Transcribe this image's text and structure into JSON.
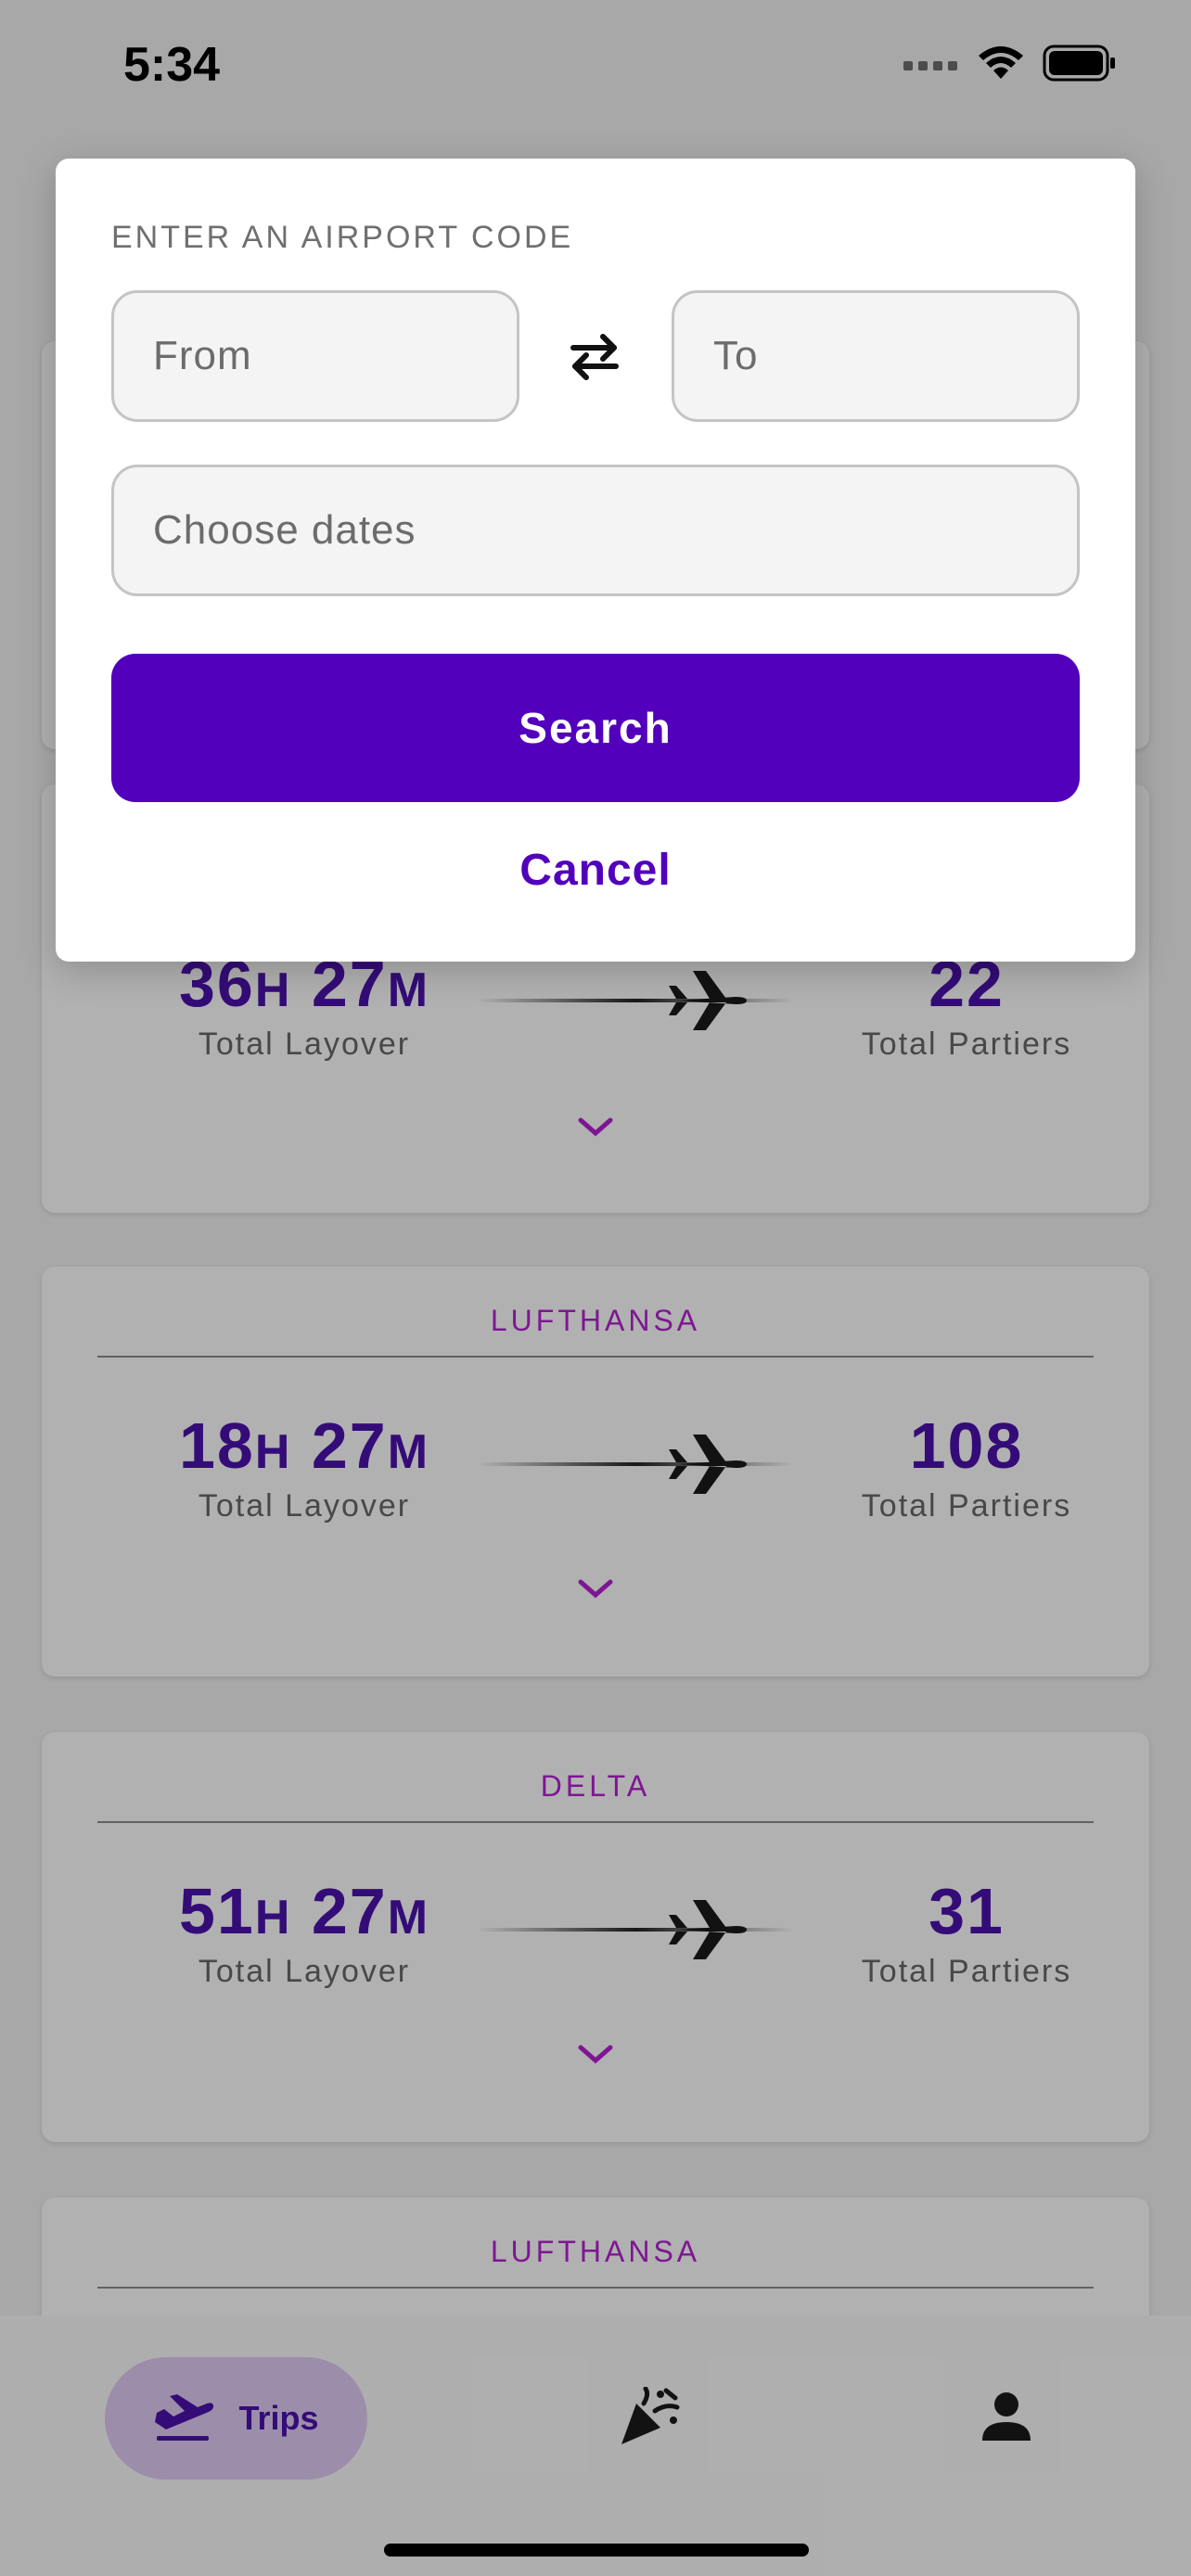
{
  "status_bar": {
    "time": "5:34"
  },
  "modal": {
    "heading": "ENTER AN AIRPORT CODE",
    "from_placeholder": "From",
    "to_placeholder": "To",
    "dates_placeholder": "Choose dates",
    "search_label": "Search",
    "cancel_label": "Cancel",
    "swap_icon": "swap-arrows-icon"
  },
  "cards": [
    {
      "airline": "",
      "layover_h": "",
      "layover_m": "",
      "partiers": "",
      "layover_label": "",
      "partiers_label": ""
    },
    {
      "airline": "",
      "layover_h": "36",
      "layover_m": "27",
      "partiers": "22",
      "layover_label": "Total Layover",
      "partiers_label": "Total Partiers"
    },
    {
      "airline": "LUFTHANSA",
      "layover_h": "18",
      "layover_m": "27",
      "partiers": "108",
      "layover_label": "Total Layover",
      "partiers_label": "Total Partiers"
    },
    {
      "airline": "DELTA",
      "layover_h": "51",
      "layover_m": "27",
      "partiers": "31",
      "layover_label": "Total Layover",
      "partiers_label": "Total Partiers"
    },
    {
      "airline": "LUFTHANSA"
    }
  ],
  "units": {
    "hours": "H",
    "minutes": "M"
  },
  "tab_bar": {
    "trips_label": "Trips",
    "tabs": [
      "plane-departure-icon",
      "party-popper-icon",
      "person-icon"
    ]
  },
  "colors": {
    "accent": "#5200bc",
    "airline_label": "#b21fd0",
    "stat_value": "#4a12a8",
    "trips_pill": "#dcc8f0"
  }
}
